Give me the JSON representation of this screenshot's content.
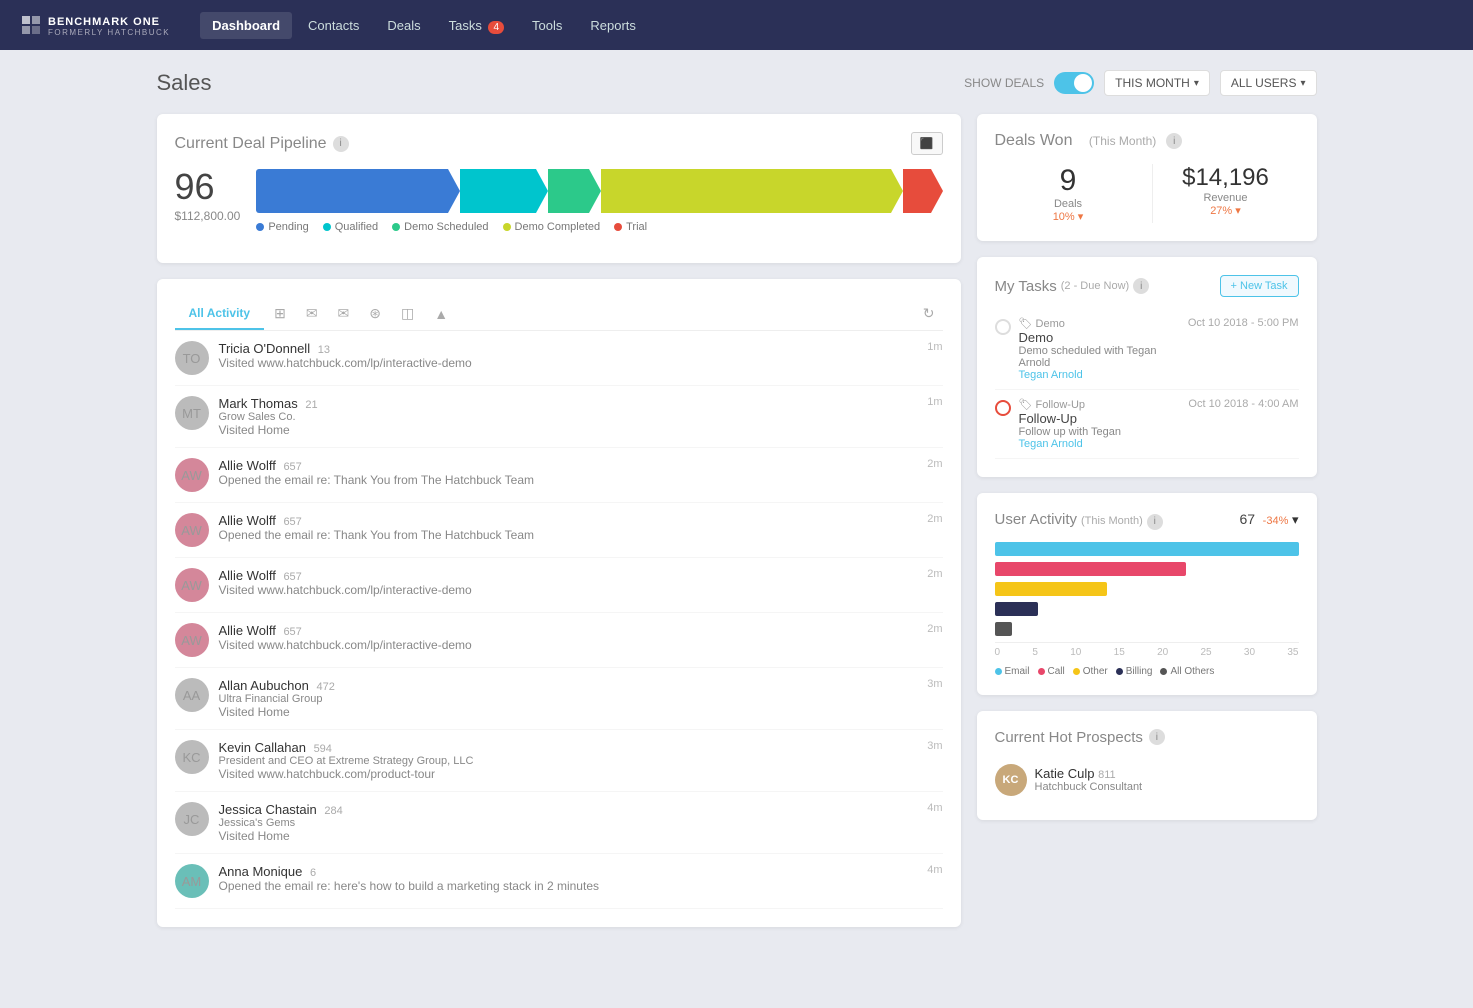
{
  "nav": {
    "brand": "BENCHMARK ONE",
    "brand_sub": "FORMERLY HATCHBUCK",
    "links": [
      {
        "label": "Dashboard",
        "active": true
      },
      {
        "label": "Contacts",
        "active": false
      },
      {
        "label": "Deals",
        "active": false
      },
      {
        "label": "Tasks",
        "active": false,
        "badge": "4"
      },
      {
        "label": "Tools",
        "active": false
      },
      {
        "label": "Reports",
        "active": false
      }
    ]
  },
  "header": {
    "title": "Sales",
    "show_deals_label": "SHOW DEALS",
    "this_month_label": "THIS MONTH",
    "all_users_label": "ALL USERS"
  },
  "pipeline": {
    "title": "Current Deal Pipeline",
    "count": "96",
    "amount": "$112,800.00",
    "legend": [
      {
        "label": "Pending",
        "color": "#3a7bd5"
      },
      {
        "label": "Qualified",
        "color": "#00c5cd"
      },
      {
        "label": "Demo Scheduled",
        "color": "#2cc98a"
      },
      {
        "label": "Demo Completed",
        "color": "#c8d62b"
      },
      {
        "label": "Trial",
        "color": "#e74c3c"
      }
    ],
    "bars": [
      {
        "color": "#3a7bd5",
        "pct": 28
      },
      {
        "color": "#00c5cd",
        "pct": 11
      },
      {
        "color": "#2cc98a",
        "pct": 6
      },
      {
        "color": "#c8d62b",
        "pct": 49
      },
      {
        "color": "#e74c3c",
        "pct": 6
      }
    ]
  },
  "activity": {
    "tabs": [
      "All Activity"
    ],
    "items": [
      {
        "name": "Tricia O'Donnell",
        "score": "13",
        "action": "Visited www.hatchbuck.com/lp/interactive-demo",
        "time": "1m",
        "avatar_initials": "TO",
        "avatar_class": "av-gray"
      },
      {
        "name": "Mark Thomas",
        "score": "21",
        "company": "Grow Sales Co.",
        "action": "Visited Home",
        "time": "1m",
        "avatar_initials": "MT",
        "avatar_class": "av-gray"
      },
      {
        "name": "Allie Wolff",
        "score": "657",
        "action": "Opened the email re: Thank You from The Hatchbuck Team",
        "time": "2m",
        "avatar_initials": "AW",
        "avatar_class": "av-pink"
      },
      {
        "name": "Allie Wolff",
        "score": "657",
        "action": "Opened the email re: Thank You from The Hatchbuck Team",
        "time": "2m",
        "avatar_initials": "AW",
        "avatar_class": "av-pink"
      },
      {
        "name": "Allie Wolff",
        "score": "657",
        "action": "Visited www.hatchbuck.com/lp/interactive-demo",
        "time": "2m",
        "avatar_initials": "AW",
        "avatar_class": "av-pink"
      },
      {
        "name": "Allie Wolff",
        "score": "657",
        "action": "Visited www.hatchbuck.com/lp/interactive-demo",
        "time": "2m",
        "avatar_initials": "AW",
        "avatar_class": "av-pink"
      },
      {
        "name": "Allan Aubuchon",
        "score": "472",
        "company": "Ultra Financial Group",
        "action": "Visited Home",
        "time": "3m",
        "avatar_initials": "AA",
        "avatar_class": "av-gray"
      },
      {
        "name": "Kevin Callahan",
        "score": "594",
        "company": "President and CEO at Extreme Strategy Group, LLC",
        "action": "Visited www.hatchbuck.com/product-tour",
        "time": "3m",
        "avatar_initials": "KC",
        "avatar_class": "av-gray"
      },
      {
        "name": "Jessica Chastain",
        "score": "284",
        "company": "Jessica's Gems",
        "action": "Visited Home",
        "time": "4m",
        "avatar_initials": "JC",
        "avatar_class": "av-gray"
      },
      {
        "name": "Anna Monique",
        "score": "6",
        "action": "Opened the email re: here's how to build a marketing stack in 2 minutes",
        "time": "4m",
        "avatar_initials": "AM",
        "avatar_class": "av-teal"
      }
    ]
  },
  "deals_won": {
    "title": "Deals Won",
    "period": "(This Month)",
    "deals_count": "9",
    "deals_label": "Deals",
    "deals_change": "10%",
    "revenue": "$14,196",
    "revenue_label": "Revenue",
    "revenue_change": "27%"
  },
  "tasks": {
    "title": "My Tasks",
    "subtitle": "(2 - Due Now)",
    "new_task_label": "+ New Task",
    "items": [
      {
        "type": "Demo",
        "name": "Demo",
        "desc": "Demo scheduled with Tegan Arnold",
        "person": "Tegan Arnold",
        "date": "Oct 10 2018 - 5:00 PM",
        "urgent": false
      },
      {
        "type": "Follow-Up",
        "name": "Follow-Up",
        "desc": "Follow up with Tegan",
        "person": "Tegan Arnold",
        "date": "Oct 10 2018 - 4:00 AM",
        "urgent": true
      }
    ]
  },
  "user_activity": {
    "title": "User Activity",
    "period": "(This Month)",
    "count": "67",
    "change": "-34%",
    "bars": [
      {
        "label": "Email",
        "color": "#4dc3e8",
        "value": 35,
        "max": 35
      },
      {
        "label": "Call",
        "color": "#e8476a",
        "value": 22,
        "max": 35
      },
      {
        "label": "Other",
        "color": "#f5c518",
        "value": 13,
        "max": 35
      },
      {
        "label": "Billing",
        "color": "#2b3057",
        "value": 5,
        "max": 35
      },
      {
        "label": "All Others",
        "color": "#555",
        "value": 2,
        "max": 35
      }
    ],
    "axis": [
      "0",
      "5",
      "10",
      "15",
      "20",
      "25",
      "30",
      "35"
    ],
    "legend": [
      {
        "label": "Email",
        "color": "#4dc3e8"
      },
      {
        "label": "Call",
        "color": "#e8476a"
      },
      {
        "label": "Other",
        "color": "#f5c518"
      },
      {
        "label": "Billing",
        "color": "#2b3057"
      },
      {
        "label": "All Others",
        "color": "#555"
      }
    ]
  },
  "prospects": {
    "title": "Current Hot Prospects",
    "items": [
      {
        "name": "Katie Culp",
        "score": "811",
        "role": "Hatchbuck Consultant",
        "avatar_initials": "KC",
        "avatar_class": "av-brown"
      }
    ]
  }
}
